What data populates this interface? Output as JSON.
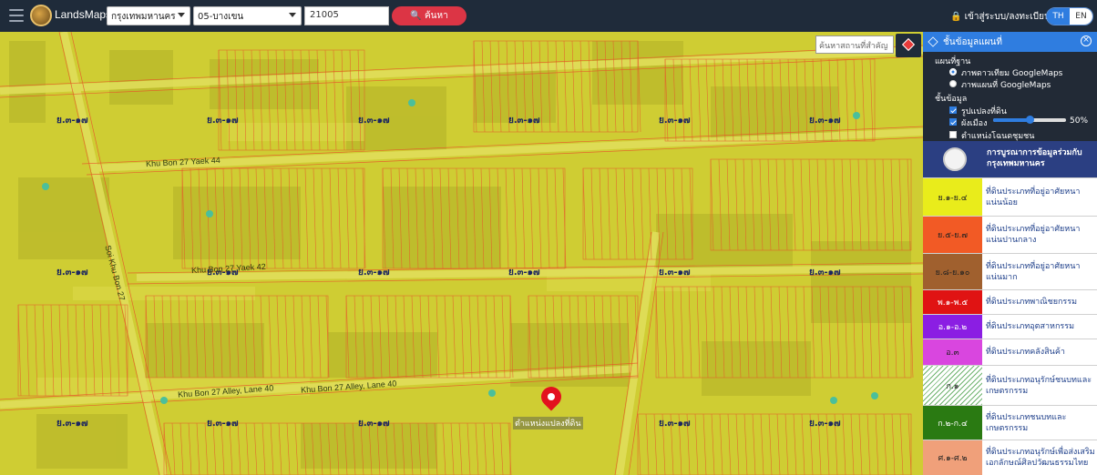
{
  "header": {
    "logo_text": "LandsMaps",
    "province": "กรุงเทพมหานคร",
    "district": "05-บางเขน",
    "code": "21005",
    "search_label": "ค้นหา",
    "login_label": "เข้าสู่ระบบ/ลงทะเบียน",
    "lang_th": "TH",
    "lang_en": "EN"
  },
  "map": {
    "search_placeholder": "ค้นหาสถานที่สำคัญ",
    "overlay_color": "#d7d81f",
    "zone_labels": [
      "ย.๓-๑๗",
      "ย.๓-๑๗",
      "ย.๓-๑๗",
      "ย.๓-๑๗",
      "ย.๓-๑๗",
      "ย.๓-๑๗",
      "ย.๓-๑๗",
      "ย.๓-๑๗",
      "ย.๓-๑๗",
      "ย.๓-๑๗",
      "ย.๓-๑๗",
      "ย.๓-๑๗",
      "ย.๓-๑๗",
      "ย.๓-๑๗",
      "ย.๓-๑๗",
      "ย.๓-๑๗",
      "ย.๓-๑๗",
      "ย.๓-๑๗"
    ],
    "pin_label": "ตำแหน่งแปลงที่ดิน",
    "streets": [
      "Khu Bon 27 Yaek 42",
      "Khu Bon 27 Alley, Lane 40",
      "Khu Bon 27 Yaek 44",
      "Khu Bon 27 Alley, Lane 40",
      "Soi Khu Bon 27"
    ]
  },
  "panel": {
    "title": "ชั้นข้อมูลแผนที่",
    "basemap_title": "แผนที่ฐาน",
    "basemap_opt1": "ภาพดาวเทียม GoogleMaps",
    "basemap_opt2": "ภาพแผนที่ GoogleMaps",
    "layers_title": "ชั้นข้อมูล",
    "layer1": "รูปแปลงที่ดิน",
    "layer2": "ผังเมือง",
    "layer3": "ตำแหน่งโฉนดชุมชน",
    "opacity": "50%",
    "opacity_value": 50
  },
  "legend": {
    "header": "การบูรณาการข้อมูลร่วมกับ กรุงเทพมหานคร",
    "items": [
      {
        "code": "ย.๑-ย.๔",
        "label": "ที่ดินประเภทที่อยู่อาศัยหนาแน่นน้อย",
        "color": "#e9ec1b"
      },
      {
        "code": "ย.๕-ย.๗",
        "label": "ที่ดินประเภทที่อยู่อาศัยหนาแน่นปานกลาง",
        "color": "#f25a25"
      },
      {
        "code": "ย.๘-ย.๑๐",
        "label": "ที่ดินประเภทที่อยู่อาศัยหนาแน่นมาก",
        "color": "#a0602e"
      },
      {
        "code": "พ.๑-พ.๕",
        "label": "ที่ดินประเภทพาณิชยกรรม",
        "color": "#e01313"
      },
      {
        "code": "อ.๑-อ.๒",
        "label": "ที่ดินประเภทอุตสาหกรรม",
        "color": "#8b1ee3"
      },
      {
        "code": "อ.๓",
        "label": "ที่ดินประเภทคลังสินค้า",
        "color": "#d946df"
      },
      {
        "code": "ก.๑",
        "label": "ที่ดินประเภทอนุรักษ์ชนบทและเกษตรกรรม",
        "color": "#ffffff"
      },
      {
        "code": "ก.๒-ก.๔",
        "label": "ที่ดินประเภทชนบทและเกษตรกรรม",
        "color": "#2a7a12"
      },
      {
        "code": "ศ.๑-ศ.๒",
        "label": "ที่ดินประเภทอนุรักษ์เพื่อส่งเสริมเอกลักษณ์ศิลปวัฒนธรรมไทย",
        "color": "#f0a07a"
      }
    ]
  }
}
